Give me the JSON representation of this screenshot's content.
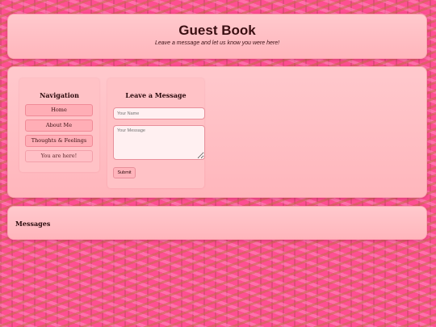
{
  "header": {
    "title": "Guest Book",
    "subtitle": "Leave a message and let us know you were here!"
  },
  "navigation": {
    "heading": "Navigation",
    "items": [
      {
        "label": "Home"
      },
      {
        "label": "About Me"
      },
      {
        "label": "Thoughts & Feelings"
      },
      {
        "label": "You are here!"
      }
    ]
  },
  "form": {
    "heading": "Leave a Message",
    "name_placeholder": "Your Name",
    "message_placeholder": "Your Message",
    "submit_label": "Submit"
  },
  "messages": {
    "heading": "Messages"
  },
  "colors": {
    "background": "#ff4f93",
    "panel": "#ffc2c6",
    "button": "#ffaeb6",
    "text": "#3a0f12"
  }
}
